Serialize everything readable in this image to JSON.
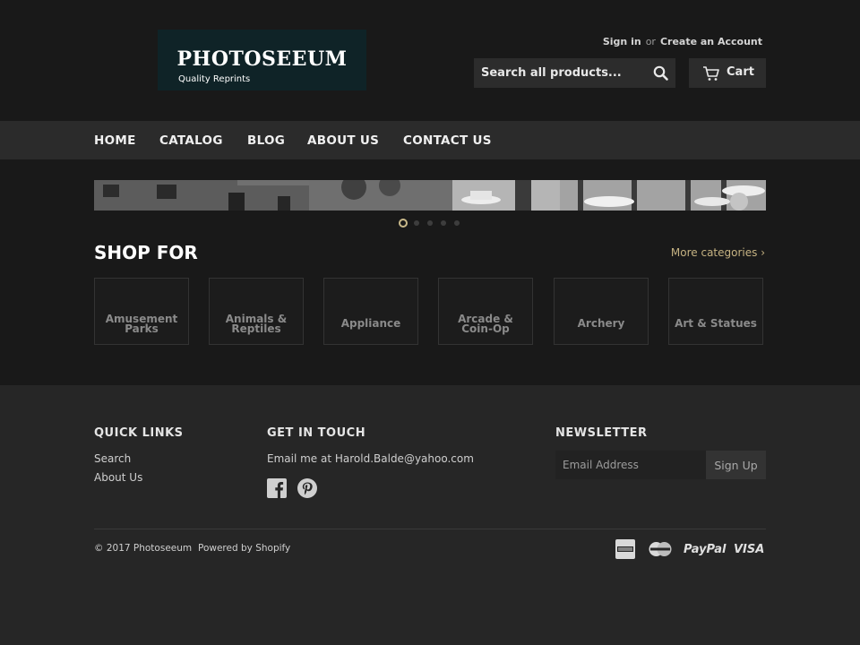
{
  "header": {
    "logo_title": "PHOTOSEEUM",
    "logo_subtitle": "Quality Reprints",
    "sign_in": "Sign in",
    "or": "or",
    "create_account": "Create an Account",
    "search_placeholder": "Search all products...",
    "cart_label": "Cart"
  },
  "nav": {
    "items": [
      "HOME",
      "CATALOG",
      "BLOG",
      "ABOUT US",
      "CONTACT US"
    ]
  },
  "slider": {
    "dot_count": 5,
    "active_index": 0
  },
  "shop": {
    "title": "SHOP FOR",
    "more_categories": "More categories ›",
    "categories": [
      "Amusement Parks",
      "Animals & Reptiles",
      "Appliance",
      "Arcade & Coin-Op",
      "Archery",
      "Art & Statues"
    ]
  },
  "footer": {
    "quick_links_title": "QUICK LINKS",
    "quick_links": [
      "Search",
      "About Us"
    ],
    "get_in_touch_title": "GET IN TOUCH",
    "contact_text": "Email me at Harold.Balde@yahoo.com",
    "newsletter_title": "NEWSLETTER",
    "email_placeholder": "Email Address",
    "signup_label": "Sign Up",
    "copyright": "© 2017 Photoseeum",
    "powered_by": "Powered by Shopify",
    "payments": [
      "american-express-icon",
      "mastercard-icon",
      "PayPal",
      "VISA"
    ]
  },
  "colors": {
    "header_bg": "#191919",
    "nav_bg": "#2b2b2b",
    "footer_bg": "#262626",
    "accent": "#c5b282"
  }
}
